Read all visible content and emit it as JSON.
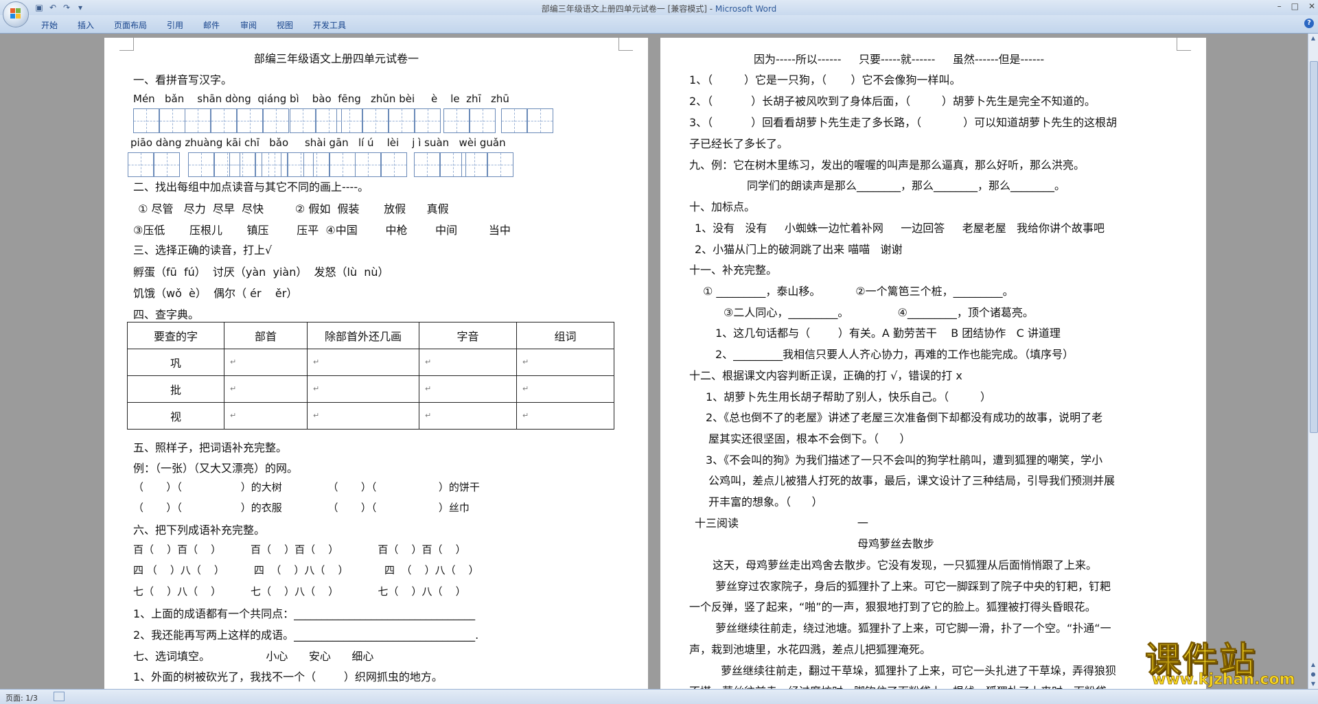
{
  "window": {
    "title": "部编三年级语文上册四单元试卷一 [兼容模式] - ",
    "app": "Microsoft Word"
  },
  "ribbon": {
    "tabs": [
      "开始",
      "插入",
      "页面布局",
      "引用",
      "邮件",
      "审阅",
      "视图",
      "开发工具"
    ]
  },
  "status": {
    "page": "页面: 1/3"
  },
  "watermark": {
    "title": "课件站",
    "url": "www.kjzhan.com"
  },
  "left_page": {
    "lines": [
      "部编三年级语文上册四单元试卷一",
      "一、看拼音写汉字。",
      "Mén   bǎn    shān dòng  qiáng bì    bào  fēng   zhǔn bèi     è    le  zhī   zhū",
      "piāo dàng zhuàng kāi chī   bǎo     shài gān   lí ú    lèi    j ì suàn   wèi guǎn",
      "二、找出每组中加点读音与其它不同的画上----。",
      " ① 尽管   尽力  尽早  尽快         ② 假如  假装       放假      真假",
      "③压低       压根儿       镇压        压平  ④中国        中枪        中间         当中",
      "三、选择正确的读音，打上√",
      "孵蛋（fū  fú）  讨厌（yàn  yiàn）  发怒（lù  nù）",
      "饥饿（wǒ  è）  偶尔（ ér    ěr）",
      "四、查字典。",
      "五、照样子，把词语补充完整。",
      "例：（一张）（又大又漂亮）的网。",
      "（       ）（                  ）的大树              （       ）（                   ）的饼干",
      "（       ）（                  ）的衣服              （       ）（                   ）丝巾",
      "六、把下列成语补充完整。",
      "百（    ）百（    ）         百（    ）百（    ）            百（    ）百（    ）",
      "四 （    ）八（    ）         四  （    ）八（    ）           四  （    ）八（    ）",
      "七（    ）八（    ）         七（    ）八（    ）            七（    ）八（    ）",
      "1、上面的成语都有一个共同点：_________________________________",
      "2、我还能再写两上这样的成语。_________________________________.",
      "七、选词填空。                小心      安心      细心",
      "1、外面的树被砍光了，我找不一个（        ）织网抓虫的地方。"
    ],
    "table": {
      "headers": [
        "要查的字",
        "部首",
        "除部首外还几画",
        "字音",
        "组词"
      ],
      "rows": [
        [
          "巩"
        ],
        [
          "批"
        ],
        [
          "视"
        ]
      ]
    }
  },
  "right_page": {
    "lines": [
      "因为-----所以------     只要-----就------     虽然------但是------",
      "1、（         ）它是一只狗，（       ）它不会像狗一样叫。",
      "2、（           ）长胡子被风吹到了身体后面，（         ）胡萝卜先生是完全不知道的。",
      "3、（           ）回看看胡萝卜先生走了多长路，（            ）可以知道胡萝卜先生的这根胡",
      "子已经长了多长了。",
      "九、例：它在树木里练习，发出的喔喔的叫声是那么逼真，那么好听，那么洪亮。",
      "同学们的朗读声是那么________，那么________，那么________。",
      "十、加标点。",
      "1、没有   没有     小蜘蛛一边忙着补网     一边回答     老屋老屋   我给你讲个故事吧",
      "2、小猫从门上的破洞跳了出来 喵喵   谢谢",
      "十一、补充完整。",
      "① _________，泰山移。          ②一个篱笆三个桩，_________。",
      "③二人同心，_________。              ④_________，顶个诸葛亮。",
      "1、这几句话都与（        ）有关。A 勤劳苦干    B 团结协作   C 讲道理",
      "2、_________我相信只要人人齐心协力，再难的工作也能完成。（填序号）",
      "十二、根据课文内容判断正误，正确的打 √，错误的打 x",
      "1、胡萝卜先生用长胡子帮助了别人，快乐自己。（         ）",
      "2、《总也倒不了的老屋》讲述了老屋三次准备倒下却都没有成功的故事，说明了老",
      "屋其实还很坚固，根本不会倒下。（      ）",
      "3、《不会叫的狗》为我们描述了一只不会叫的狗学杜鹃叫，遭到狐狸的嘲笑，学小",
      "公鸡叫，差点儿被猎人打死的故事，最后，课文设计了三种结局，引导我们预测并展",
      "开丰富的想象。（      ）",
      "十三阅读                                  一",
      "母鸡萝丝去散步",
      "这天，母鸡萝丝走出鸡舍去散步。它没有发现，一只狐狸从后面悄悄跟了上来。",
      "萝丝穿过农家院子，身后的狐狸扑了上来。可它一脚踩到了院子中央的钉耙，钉耙",
      "一个反弹，竖了起来，“啪”的一声，狠狠地打到了它的脸上。狐狸被打得头昏眼花。",
      "萝丝继续往前走，绕过池塘。狐狸扑了上来，可它脚一滑，扑了一个空。“扑通“一",
      "声，栽到池塘里，水花四溅，差点儿把狐狸淹死。",
      "萝丝继续往前走，翻过干草垛，狐狸扑了上来，可它一头扎进了干草垛，弄得狼狈",
      "不堪。萝丝往前走，经过磨坊时，脚钩住了面粉袋上一根线。狐狸扑了上来时，面粉袋"
    ]
  }
}
